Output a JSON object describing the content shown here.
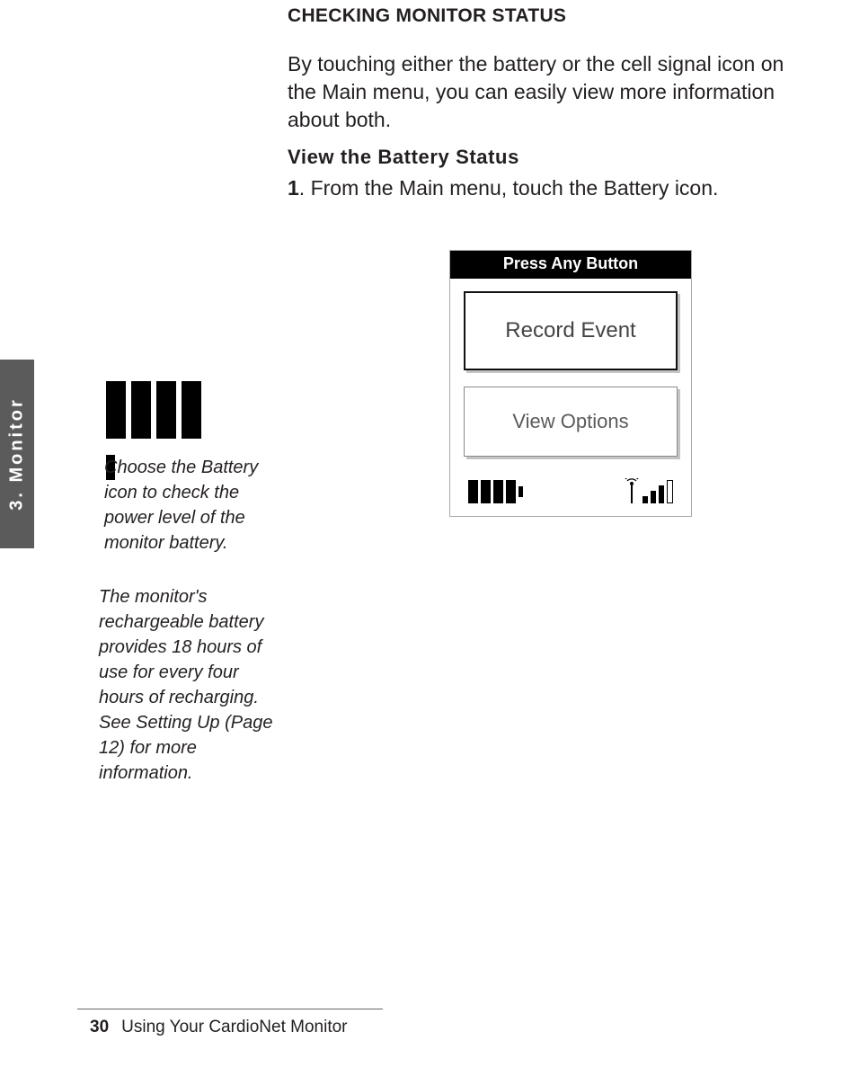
{
  "heading": "CHECKING MONITOR STATUS",
  "intro": "By touching either the battery or the cell signal icon on the Main menu, you can easily view more information about both.",
  "subheading": "View the Battery Status",
  "step1_num": "1",
  "step1_text": ". From the Main menu, touch the Battery icon.",
  "side_tab": "3. Monitor",
  "caption1": "Choose the Battery icon to check the power level of the monitor battery.",
  "caption2": "The monitor's rechargeable battery provides 18 hours of use for every four hours of recharging.  See Setting Up (Page 12) for more information.",
  "device": {
    "header": "Press Any Button",
    "button1": "Record Event",
    "button2": "View Options"
  },
  "footer": {
    "page": "30",
    "title": "Using Your CardioNet Monitor"
  }
}
